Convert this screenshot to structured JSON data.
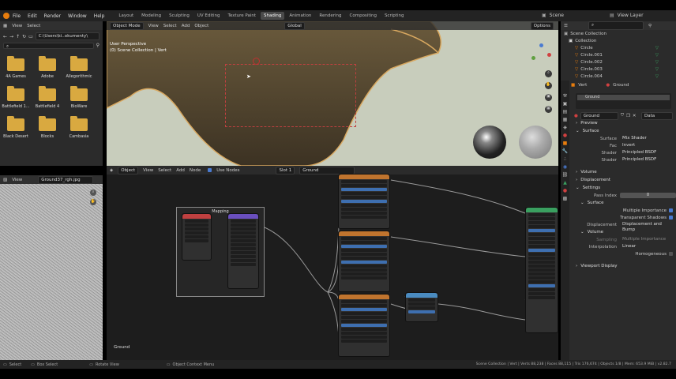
{
  "menu": [
    "File",
    "Edit",
    "Render",
    "Window",
    "Help"
  ],
  "workspaces": [
    "Layout",
    "Modeling",
    "Sculpting",
    "UV Editing",
    "Texture Paint",
    "Shading",
    "Animation",
    "Rendering",
    "Compositing",
    "Scripting"
  ],
  "active_workspace": "Shading",
  "scene": {
    "label": "Scene",
    "view_layer": "View Layer"
  },
  "file_browser": {
    "header": [
      "View",
      "Select"
    ],
    "path": "C:\\Users\\ki..okumenty\\",
    "folders": [
      "4A Games",
      "Adobe",
      "Allegorithmic",
      "Battlefield 1...",
      "Battlefield 4",
      "BioWare",
      "Black Desert",
      "Blocks",
      "Cambasia"
    ]
  },
  "image_editor": {
    "header": [
      "View"
    ],
    "image_name": "Ground37_rgh.jpg"
  },
  "viewport": {
    "header": [
      "Object Mode",
      "View",
      "Select",
      "Add",
      "Object"
    ],
    "transform": "Global",
    "options": "Options",
    "overlay_line1": "User Perspective",
    "overlay_line2": "(0) Scene Collection | Vert"
  },
  "node_editor": {
    "header": [
      "Object",
      "View",
      "Select",
      "Add",
      "Node"
    ],
    "use_nodes": "Use Nodes",
    "slot": "Slot 1",
    "material": "Ground",
    "mapping_frame": "Mapping",
    "footer_label": "Ground"
  },
  "outliner": {
    "root": "Scene Collection",
    "items": [
      "Collection",
      "Circle",
      "Circle.001",
      "Circle.002",
      "Circle.003",
      "Circle.004"
    ]
  },
  "properties": {
    "object": "Vert",
    "material_slot": "Ground",
    "material_name": "Ground",
    "data": "Data",
    "sections": [
      "Preview",
      "Surface",
      "Volume",
      "Displacement",
      "Settings",
      "Viewport Display"
    ],
    "surface": [
      {
        "label": "Surface",
        "value": "Mix Shader"
      },
      {
        "label": "Fac",
        "value": "Invert"
      },
      {
        "label": "Shader",
        "value": "Principled BSDF"
      },
      {
        "label": "Shader",
        "value": "Principled BSDF"
      }
    ],
    "pass_index": {
      "label": "Pass Index",
      "value": "0"
    },
    "settings_surface": "Surface",
    "multiple_importance": "Multiple Importance",
    "transparent_shadows": "Transparent Shadows",
    "displacement": {
      "label": "Displacement",
      "value": "Displacement and Bump"
    },
    "volume_label": "Volume",
    "sampling": {
      "label": "Sampling",
      "value": "Multiple Importance"
    },
    "interpolation": {
      "label": "Interpolation",
      "value": "Linear"
    },
    "homogeneous": "Homogeneous"
  },
  "status": {
    "left": [
      "Select",
      "Box Select",
      "Rotate View",
      "Object Context Menu"
    ],
    "right": "Scene Collection | Vert | Verts 88,238 | Faces 88,115 | Tris 176,674 | Objects 1/8 | Mem: 653.9 MiB | v2.82.7"
  },
  "colors": {
    "accent": "#e87d0d",
    "blue": "#4a7bd1",
    "bg": "#2b2b2b"
  }
}
